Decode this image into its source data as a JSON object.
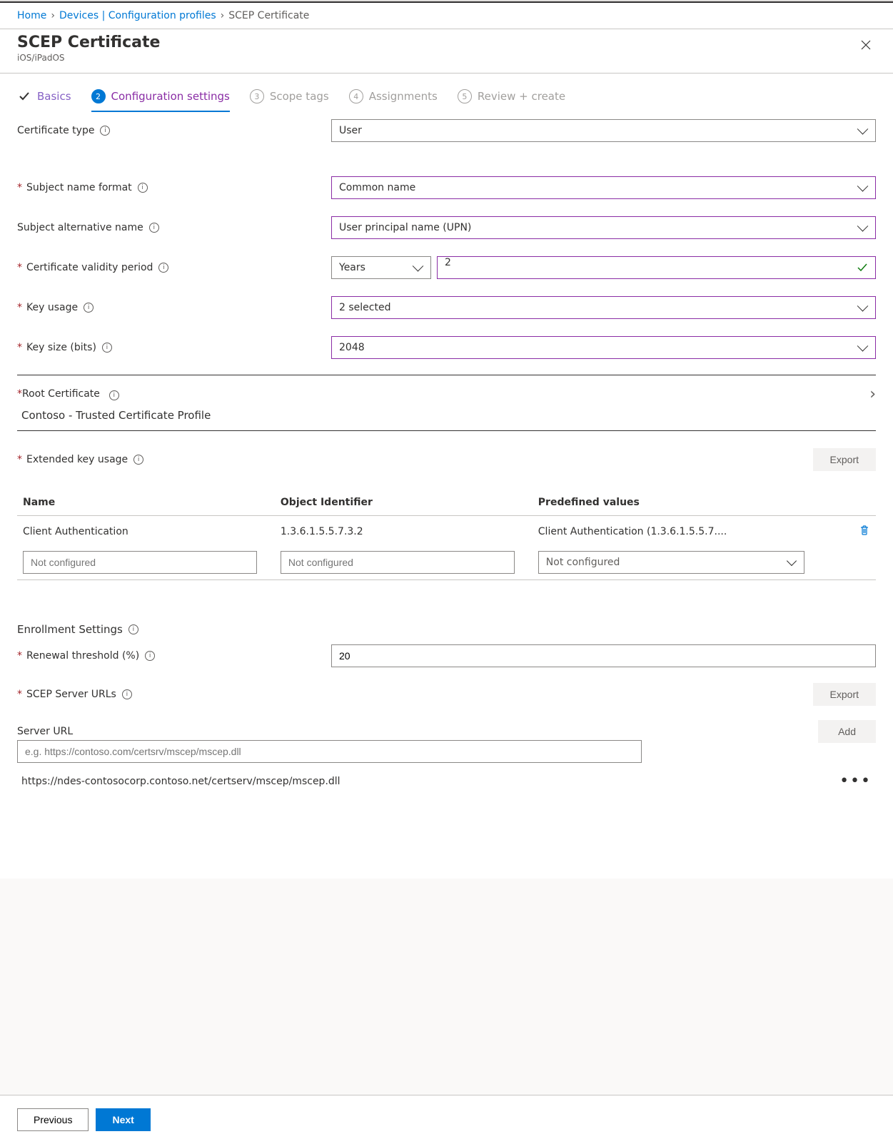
{
  "breadcrumb": [
    "Home",
    "Devices | Configuration profiles",
    "SCEP Certificate"
  ],
  "header": {
    "title": "SCEP Certificate",
    "subtitle": "iOS/iPadOS"
  },
  "steps": [
    {
      "num": "✓",
      "label": "Basics"
    },
    {
      "num": "2",
      "label": "Configuration settings"
    },
    {
      "num": "3",
      "label": "Scope tags"
    },
    {
      "num": "4",
      "label": "Assignments"
    },
    {
      "num": "5",
      "label": "Review + create"
    }
  ],
  "form": {
    "cert_type": {
      "label": "Certificate type",
      "value": "User"
    },
    "subject_name": {
      "label": "Subject name format",
      "value": "Common name"
    },
    "san": {
      "label": "Subject alternative name",
      "value": "User principal name (UPN)"
    },
    "validity": {
      "label": "Certificate validity period",
      "unit": "Years",
      "value": "2"
    },
    "key_usage": {
      "label": "Key usage",
      "value": "2 selected"
    },
    "key_size": {
      "label": "Key size (bits)",
      "value": "2048"
    },
    "root_cert": {
      "label": "Root Certificate",
      "value": "Contoso - Trusted Certificate Profile"
    },
    "eku": {
      "label": "Extended key usage",
      "columns": [
        "Name",
        "Object Identifier",
        "Predefined values"
      ],
      "rows": [
        {
          "name": "Client Authentication",
          "oid": "1.3.6.1.5.5.7.3.2",
          "predefined": "Client Authentication (1.3.6.1.5.5.7...."
        }
      ],
      "placeholder": "Not configured"
    },
    "enrollment": {
      "heading": "Enrollment Settings",
      "renewal_label": "Renewal threshold (%)",
      "renewal_value": "20",
      "scep_label": "SCEP Server URLs",
      "server_url_label": "Server URL",
      "server_url_placeholder": "e.g. https://contoso.com/certsrv/mscep/mscep.dll",
      "urls": [
        "https://ndes-contosocorp.contoso.net/certserv/mscep/mscep.dll"
      ]
    }
  },
  "buttons": {
    "export": "Export",
    "add": "Add",
    "previous": "Previous",
    "next": "Next"
  }
}
